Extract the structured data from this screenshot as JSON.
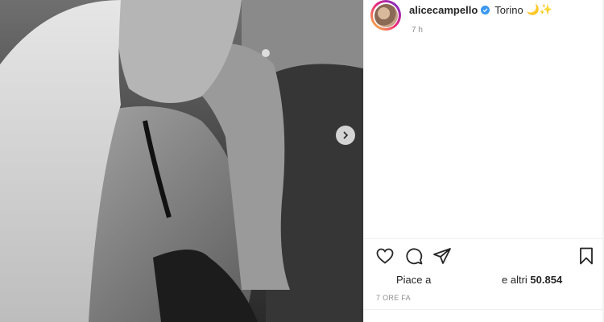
{
  "post": {
    "username": "alicecampello",
    "location": "Torino",
    "location_emoji": "🌙✨",
    "time_short": "7 h",
    "likes_prefix": "Piace a",
    "likes_suffix_pre": "e altri ",
    "likes_count": "50.854",
    "time_ago": "7 ORE FA"
  },
  "icons": {
    "verified": "verified-badge-icon",
    "next": "chevron-right-icon",
    "like": "heart-icon",
    "comment": "comment-icon",
    "share": "paper-plane-icon",
    "save": "bookmark-icon"
  },
  "colors": {
    "verified": "#3897f0",
    "muted": "#8e8e8e",
    "text": "#262626"
  }
}
